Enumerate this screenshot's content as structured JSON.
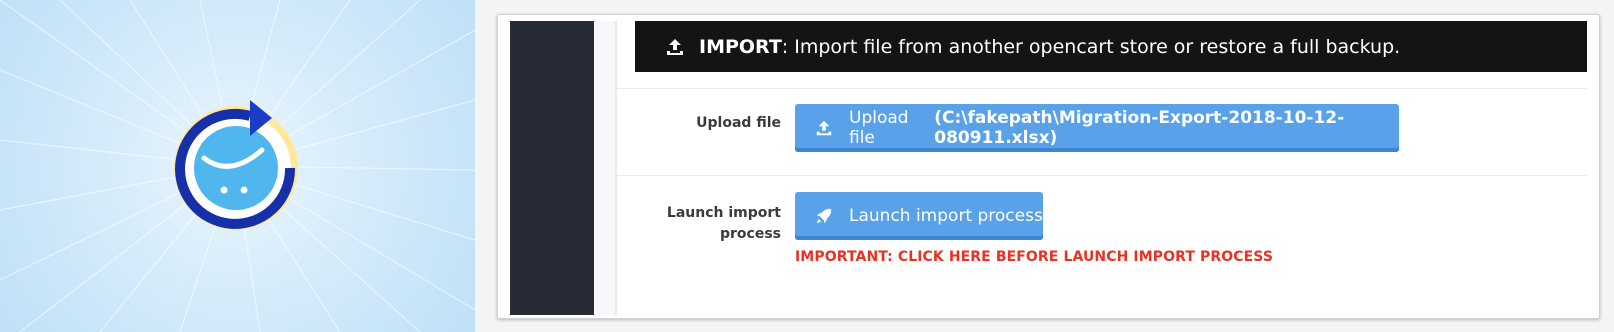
{
  "import_header": {
    "title": "IMPORT",
    "description": ": Import file from another opencart store or restore a full backup."
  },
  "upload": {
    "label": "Upload file",
    "button_text": "Upload file",
    "filename": "(C:\\fakepath\\Migration-Export-2018-10-12-080911.xlsx)"
  },
  "launch": {
    "label_line1": "Launch import",
    "label_line2": "process",
    "button_text": "Launch import process",
    "warning": "IMPORTANT: CLICK HERE BEFORE LAUNCH IMPORT PROCESS"
  },
  "icons": {
    "header": "upload-icon",
    "upload_button": "upload-icon",
    "launch_button": "rocket-icon",
    "hero": "opencart-cart-refresh-icon"
  },
  "colors": {
    "hero_bg": "#cfe8fa",
    "sidebar": "#262b36",
    "header_bg": "#141414",
    "button": "#59a2ea",
    "warning": "#e63324"
  }
}
